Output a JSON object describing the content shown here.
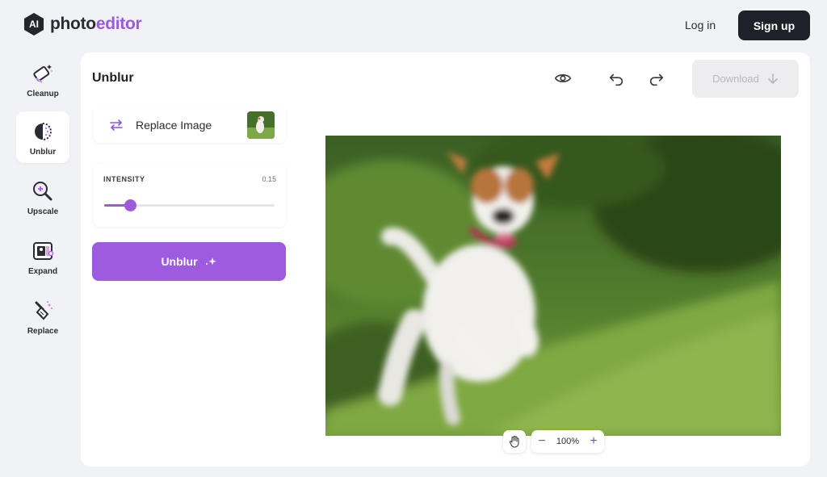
{
  "brand": {
    "badge": "AI",
    "name_part1": "photo",
    "name_part2": "editor"
  },
  "header": {
    "login_label": "Log in",
    "signup_label": "Sign up"
  },
  "tools": [
    {
      "label": "Cleanup",
      "icon": "eraser-icon",
      "active": false
    },
    {
      "label": "Unblur",
      "icon": "unblur-icon",
      "active": true
    },
    {
      "label": "Upscale",
      "icon": "magnifier-icon",
      "active": false
    },
    {
      "label": "Expand",
      "icon": "expand-icon",
      "active": false
    },
    {
      "label": "Replace",
      "icon": "brush-icon",
      "active": false
    }
  ],
  "panel": {
    "title": "Unblur",
    "replace_label": "Replace Image",
    "intensity_label": "INTENSITY",
    "intensity_value": "0.15",
    "intensity_fraction": 0.15,
    "action_label": "Unblur"
  },
  "toolbar": {
    "download_label": "Download"
  },
  "zoom": {
    "value": "100%"
  },
  "colors": {
    "accent": "#9d5be0",
    "dark": "#1f2128",
    "background": "#f1f2f6"
  }
}
